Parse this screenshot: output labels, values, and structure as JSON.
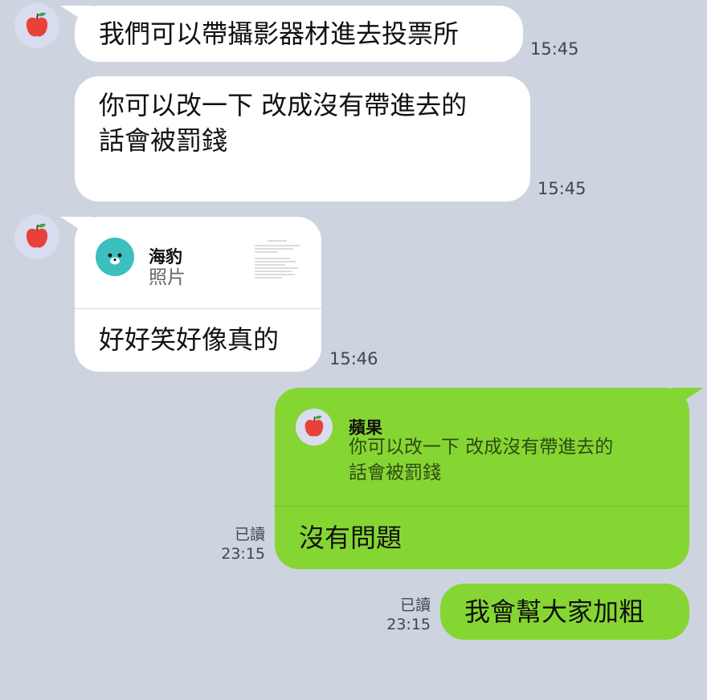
{
  "messages": [
    {
      "text": "我們可以帶攝影器材進去投票所",
      "time": "15:45"
    },
    {
      "text": "你可以改一下 改成沒有帶進去的\n話會被罰錢",
      "time": "15:45"
    },
    {
      "reply_name": "海豹",
      "reply_type": "照片",
      "text": "好好笑好像真的",
      "time": "15:46"
    },
    {
      "reply_name": "蘋果",
      "reply_text": "你可以改一下 改成沒有帶進去的\n話會被罰錢",
      "text": "沒有問題",
      "read": "已讀",
      "time": "23:15"
    },
    {
      "text": "我會幫大家加粗",
      "read": "已讀",
      "time": "23:15"
    }
  ],
  "colors": {
    "background": "#cdd4e0",
    "incoming_bubble": "#ffffff",
    "outgoing_bubble": "#86d633",
    "seal_avatar": "#3bbfbf",
    "apple_red": "#e8413a",
    "leaf_green": "#3aa64a"
  },
  "icons": {
    "sender_avatar": "apple-icon",
    "reply_avatar_seal": "seal-icon",
    "reply_thumbnail": "document-thumbnail"
  }
}
